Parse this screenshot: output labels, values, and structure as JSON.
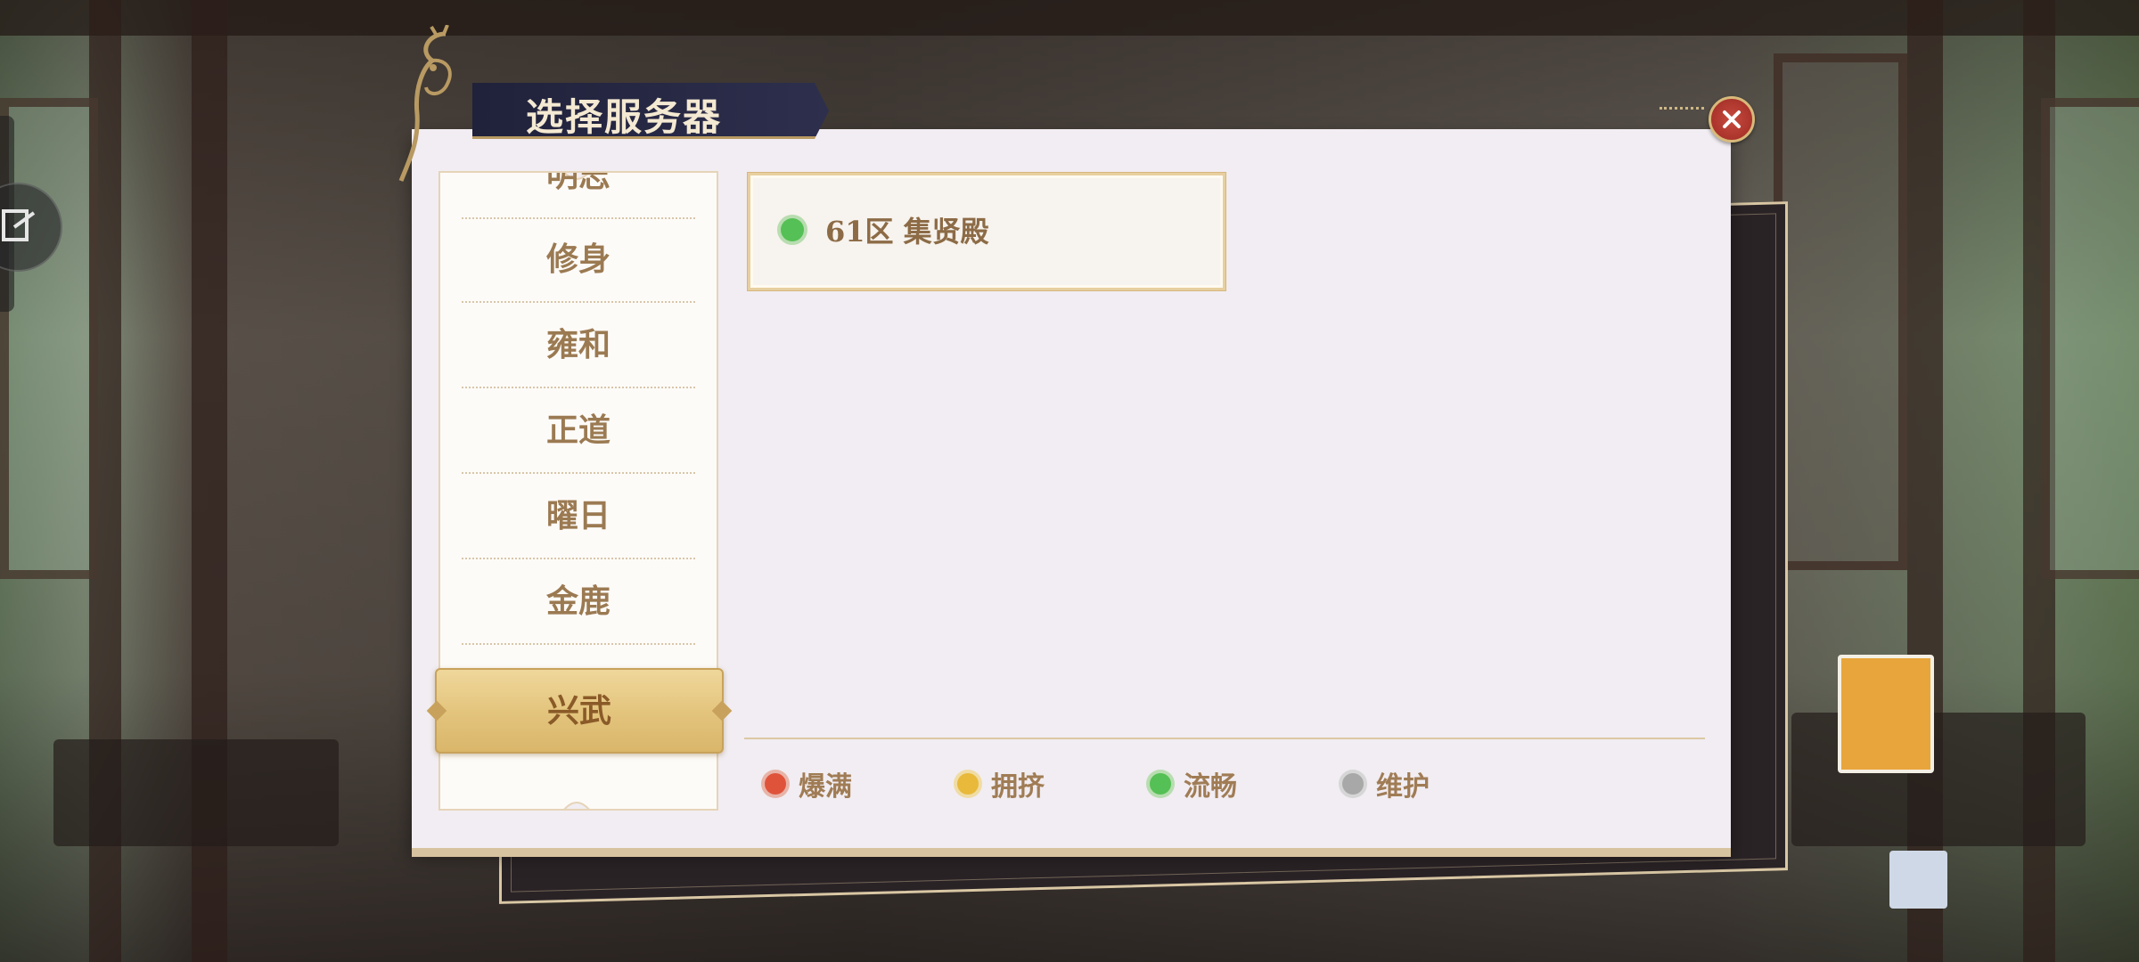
{
  "dialog": {
    "title": "选择服务器"
  },
  "sidebar": {
    "items": [
      {
        "label": "明志"
      },
      {
        "label": "修身"
      },
      {
        "label": "雍和"
      },
      {
        "label": "正道"
      },
      {
        "label": "曜日"
      },
      {
        "label": "金鹿"
      }
    ],
    "selected": {
      "label": "兴武"
    }
  },
  "servers": [
    {
      "label": "61区 集贤殿",
      "status": "流畅",
      "color": "#55c055"
    }
  ],
  "legend": [
    {
      "label": "爆满",
      "color": "#e0533b"
    },
    {
      "label": "拥挤",
      "color": "#e8b93a"
    },
    {
      "label": "流畅",
      "color": "#55c055"
    },
    {
      "label": "维护",
      "color": "#a8a8a8"
    }
  ]
}
